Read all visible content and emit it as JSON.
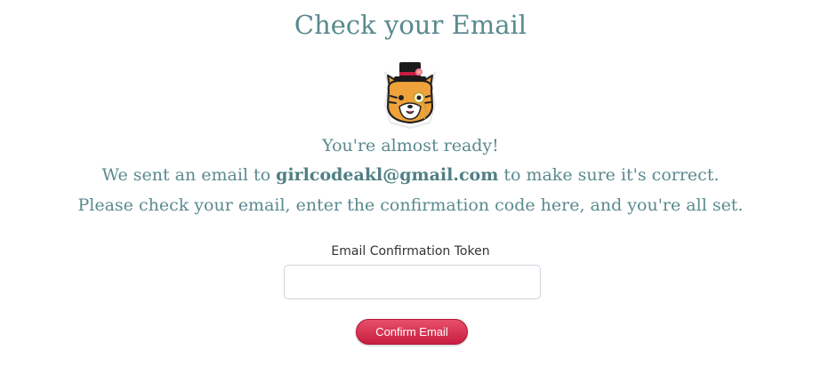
{
  "page": {
    "title": "Check your Email"
  },
  "message": {
    "line1": "You're almost ready!",
    "line2_prefix": "We sent an email to ",
    "email": "girlcodeakl@gmail.com",
    "line2_suffix": " to make sure it's correct.",
    "line3": "Please check your email, enter the confirmation code here, and you're all set."
  },
  "form": {
    "token_label": "Email Confirmation Token",
    "token_value": "",
    "confirm_label": "Confirm Email"
  },
  "icons": {
    "mascot": "cat-with-top-hat-and-monocle-icon"
  },
  "colors": {
    "heading": "#5a8a8f",
    "button": "#c81d40"
  }
}
